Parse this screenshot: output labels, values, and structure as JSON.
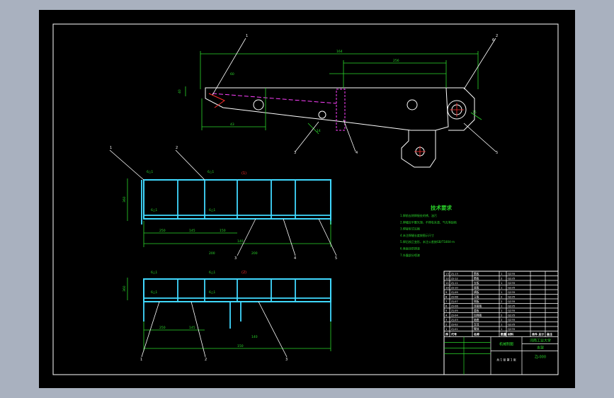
{
  "drawing": {
    "background": "#a9b1bf",
    "paper_color": "#000000",
    "line_colors": {
      "outline": "#ffffff",
      "dimension": "#2bd82b",
      "section": "#40d9ff",
      "center": "#ff40ff",
      "axis": "#ff3030"
    }
  },
  "arm_view": {
    "dimensions": [
      "164",
      "256",
      "60",
      "43",
      "40",
      "75",
      "14"
    ],
    "callouts": [
      "1",
      "2",
      "3",
      "4",
      "5",
      "6"
    ]
  },
  "section_views": {
    "upper": {
      "marker": "(1)",
      "weld_notes": [
        "6△1",
        "6△1",
        "6△1",
        "6△1"
      ],
      "dimensions": [
        "360",
        "250",
        "145",
        "150",
        "140",
        "200",
        "200"
      ],
      "callouts": [
        "1",
        "2",
        "3",
        "4",
        "5"
      ]
    },
    "lower": {
      "marker": "(2)",
      "weld_notes": [
        "6△1",
        "6△1",
        "6△1",
        "6△1"
      ],
      "dimensions": [
        "360",
        "250",
        "145",
        "150",
        "140"
      ],
      "callouts": [
        "1",
        "2",
        "3"
      ]
    }
  },
  "technical_requirements": {
    "title": "技术要求",
    "items": [
      "1.焊前去除焊接处的锈、油污",
      "2.焊缝应平整光滑，不得有夹渣、气孔等缺陷",
      "3.焊接型式见图",
      "4.未注焊缝长度按图示尺寸",
      "5.焊后校正变形，未注公差按GB/T1804-m",
      "6.表面涂防锈漆",
      "7.外露部分喷漆"
    ]
  },
  "title_block": {
    "school": "河南工业大学",
    "drawing_name": "支架",
    "drawing_number": "ZJ-000",
    "part_label": "机械制图",
    "sheet_info": "共 1 张 第 1 张",
    "header": [
      "序",
      "代号",
      "名称",
      "数量",
      "材料",
      "单件 总计",
      "备注"
    ],
    "parts": [
      [
        "13",
        "ZJ-13",
        "筋板",
        "1",
        "Q235"
      ],
      [
        "12",
        "ZJ-12",
        "筋板",
        "2",
        "Q235"
      ],
      [
        "11",
        "ZJ-11",
        "支板",
        "1",
        "Q235"
      ],
      [
        "10",
        "ZJ-10",
        "底板",
        "1",
        "Q235"
      ],
      [
        "9",
        "ZJ-09",
        "横板",
        "1",
        "Q235"
      ],
      [
        "8",
        "ZJ-08",
        "立板",
        "2",
        "Q235"
      ],
      [
        "7",
        "ZJ-07",
        "侧板",
        "2",
        "Q235"
      ],
      [
        "6",
        "ZJ-06",
        "连接板",
        "1",
        "Q235"
      ],
      [
        "5",
        "ZJ-05",
        "盖板",
        "1",
        "Q235"
      ],
      [
        "4",
        "ZJ-04",
        "加强板",
        "2",
        "Q235"
      ],
      [
        "3",
        "ZJ-03",
        "轴套",
        "2",
        "Q235"
      ],
      [
        "2",
        "ZJ-02",
        "支耳",
        "1",
        "Q235"
      ],
      [
        "1",
        "ZJ-01",
        "臂体",
        "1",
        "Q235"
      ]
    ]
  }
}
